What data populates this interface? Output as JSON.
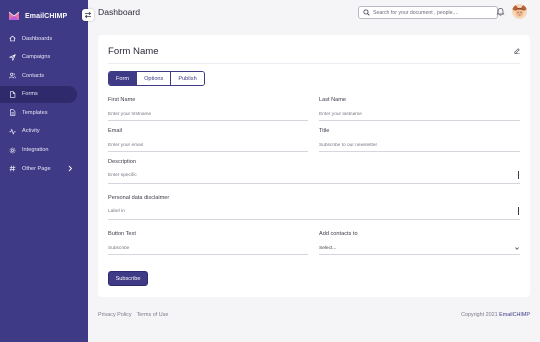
{
  "app": {
    "brand_name": "EmailCHIMP"
  },
  "sidebar": {
    "items": [
      {
        "label": "Dashboards",
        "icon": "home-icon"
      },
      {
        "label": "Campaigns",
        "icon": "send-icon"
      },
      {
        "label": "Contacts",
        "icon": "users-icon"
      },
      {
        "label": "Forms",
        "icon": "file-icon",
        "active": true
      },
      {
        "label": "Templates",
        "icon": "file-text-icon"
      },
      {
        "label": "Activity",
        "icon": "activity-icon"
      },
      {
        "label": "Integration",
        "icon": "settings-icon"
      },
      {
        "label": "Other Page",
        "icon": "hash-icon",
        "has_submenu": true
      }
    ]
  },
  "header": {
    "title": "Dashboard",
    "search_placeholder": "Search for your document , people...."
  },
  "card": {
    "title": "Form Name",
    "tabs": [
      {
        "label": "Form",
        "active": true
      },
      {
        "label": "Options"
      },
      {
        "label": "Publish"
      }
    ],
    "fields": {
      "first_name": {
        "label": "First Name",
        "placeholder": "Enter your firstname"
      },
      "last_name": {
        "label": "Last Name",
        "placeholder": "Enter your lastname"
      },
      "email": {
        "label": "Email",
        "placeholder": "Enter your email"
      },
      "title": {
        "label": "Title",
        "placeholder": "Subscribe to our newsletter"
      },
      "description": {
        "label": "Description",
        "placeholder": "Enter specific"
      },
      "disclaimer": {
        "label": "Personal data disclaimer",
        "placeholder": "Label in"
      },
      "button_text": {
        "label": "Button Text",
        "placeholder": "Subscribe"
      },
      "add_contacts": {
        "label": "Add contacts to",
        "value": "Select..."
      }
    },
    "submit_label": "Subscribe"
  },
  "footer": {
    "privacy": "Privacy Policy",
    "terms": "Terms of Use",
    "copyright": "Copyright 2021",
    "copyright_brand": "EmailCHIMP"
  },
  "colors": {
    "sidebar_bg": "#3f3a86",
    "active_bg": "#2e2a6b",
    "accent": "#3f3a86",
    "page_bg": "#f5f5f7"
  }
}
